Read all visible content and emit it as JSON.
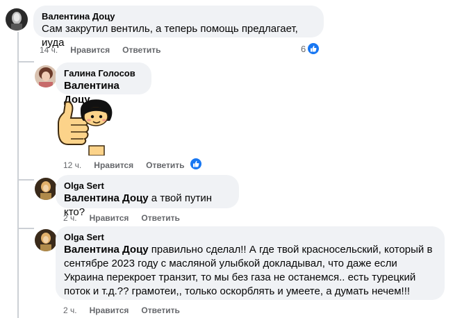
{
  "comments": [
    {
      "author": "Валентина Доцу",
      "text": "Сам закрутил вентиль, а теперь помощь предлагает, иуда",
      "time": "14 ч.",
      "like_label": "Нравится",
      "reply_label": "Ответить",
      "reaction_count": "6",
      "reaction_icon": "like-icon"
    },
    {
      "author": "Галина Голосов",
      "mention": "Валентина Доцу",
      "text": "",
      "sticker": "thumbs-up-girl-sticker",
      "time": "12 ч.",
      "like_label": "Нравится",
      "reply_label": "Ответить",
      "reaction_icon": "like-icon"
    },
    {
      "author": "Olga Sert",
      "mention": "Валентина Доцу",
      "text": " а твой путин кто?",
      "time": "2 ч.",
      "like_label": "Нравится",
      "reply_label": "Ответить"
    },
    {
      "author": "Olga Sert",
      "mention": "Валентина Доцу",
      "text": " правильно сделал!! А где твой красносельский, который в сентябре 2023 году с масляной улыбкой докладывал, что даже если Украина перекроет транзит, то мы без газа не останемся.. есть турецкий поток и т.д.?? грамотеи,, только оскорблять и умеете, а думать нечем!!!",
      "time": "2 ч.",
      "like_label": "Нравится",
      "reply_label": "Ответить"
    }
  ],
  "colors": {
    "bubble": "#f0f2f5",
    "like_blue": "#1877f2",
    "meta_gray": "#65676b"
  }
}
